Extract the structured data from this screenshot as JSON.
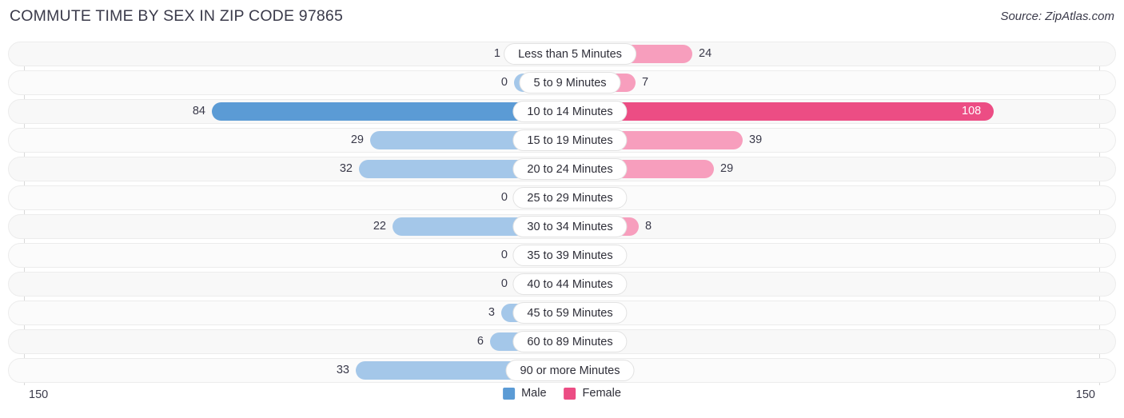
{
  "header": {
    "title": "COMMUTE TIME BY SEX IN ZIP CODE 97865",
    "source": "Source: ZipAtlas.com"
  },
  "footer": {
    "axis_left_label": "150",
    "axis_right_label": "150",
    "legend": [
      {
        "label": "Male",
        "color": "#5b9bd5"
      },
      {
        "label": "Female",
        "color": "#ec4d84"
      }
    ]
  },
  "colors": {
    "male": "#a4c7e9",
    "female": "#f79ebd",
    "male_highlight": "#5b9bd5",
    "female_highlight": "#ec4d84",
    "track": "#f8f8f8",
    "text": "#3a3a4a"
  },
  "chart_data": {
    "type": "bar",
    "subtype": "diverging-bidirectional",
    "title": "COMMUTE TIME BY SEX IN ZIP CODE 97865",
    "xlabel": "",
    "ylabel": "",
    "xlim": [
      150,
      150
    ],
    "axis_max": 150,
    "grid": false,
    "legend_position": "bottom-center",
    "categories": [
      "Less than 5 Minutes",
      "5 to 9 Minutes",
      "10 to 14 Minutes",
      "15 to 19 Minutes",
      "20 to 24 Minutes",
      "25 to 29 Minutes",
      "30 to 34 Minutes",
      "35 to 39 Minutes",
      "40 to 44 Minutes",
      "45 to 59 Minutes",
      "60 to 89 Minutes",
      "90 or more Minutes"
    ],
    "series": [
      {
        "name": "Male",
        "direction": "left",
        "values": [
          1,
          0,
          84,
          29,
          32,
          0,
          22,
          0,
          0,
          3,
          6,
          33
        ]
      },
      {
        "name": "Female",
        "direction": "right",
        "values": [
          24,
          7,
          108,
          39,
          29,
          0,
          8,
          0,
          0,
          0,
          0,
          0
        ]
      }
    ],
    "highlighted_category": "10 to 14 Minutes"
  },
  "rows": [
    {
      "label": "Less than 5 Minutes",
      "male": "1",
      "female": "24",
      "male_w": 69,
      "female_w": 163,
      "hl": false,
      "female_inside": false
    },
    {
      "label": "5 to 9 Minutes",
      "male": "0",
      "female": "7",
      "male_w": 60,
      "female_w": 92,
      "hl": false,
      "female_inside": false
    },
    {
      "label": "10 to 14 Minutes",
      "male": "84",
      "female": "108",
      "male_w": 438,
      "female_w": 540,
      "hl": true,
      "female_inside": true
    },
    {
      "label": "15 to 19 Minutes",
      "male": "29",
      "female": "39",
      "male_w": 240,
      "female_w": 226,
      "hl": false,
      "female_inside": false
    },
    {
      "label": "20 to 24 Minutes",
      "male": "32",
      "female": "29",
      "male_w": 254,
      "female_w": 190,
      "hl": false,
      "female_inside": false
    },
    {
      "label": "25 to 29 Minutes",
      "male": "0",
      "female": "0",
      "male_w": 60,
      "female_w": 60,
      "hl": false,
      "female_inside": false
    },
    {
      "label": "30 to 34 Minutes",
      "male": "22",
      "female": "8",
      "male_w": 212,
      "female_w": 96,
      "hl": false,
      "female_inside": false
    },
    {
      "label": "35 to 39 Minutes",
      "male": "0",
      "female": "0",
      "male_w": 60,
      "female_w": 60,
      "hl": false,
      "female_inside": false
    },
    {
      "label": "40 to 44 Minutes",
      "male": "0",
      "female": "0",
      "male_w": 60,
      "female_w": 60,
      "hl": false,
      "female_inside": false
    },
    {
      "label": "45 to 59 Minutes",
      "male": "3",
      "female": "0",
      "male_w": 76,
      "female_w": 60,
      "hl": false,
      "female_inside": false
    },
    {
      "label": "60 to 89 Minutes",
      "male": "6",
      "female": "0",
      "male_w": 90,
      "female_w": 60,
      "hl": false,
      "female_inside": false
    },
    {
      "label": "90 or more Minutes",
      "male": "33",
      "female": "0",
      "male_w": 258,
      "female_w": 60,
      "hl": false,
      "female_inside": false
    }
  ]
}
